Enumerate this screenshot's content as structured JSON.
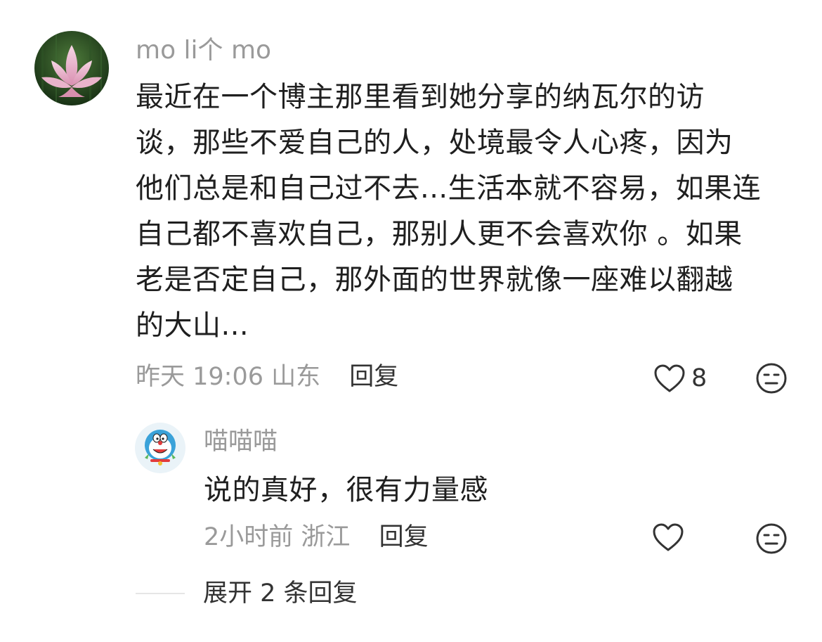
{
  "comment": {
    "avatar_icon": "lotus-flower-avatar",
    "username": "mo li个 mo",
    "lines": [
      "最近在一个博主那里看到她分享的纳瓦尔的访",
      "谈，那些不爱自己的人，处境最令人心疼，因为",
      "他们总是和自己过不去...生活本就不容易，如果连",
      "自己都不喜欢自己，那别人更不会喜欢你 。如果",
      "老是否定自己，那外面的世界就像一座难以翻越",
      "的大山..."
    ],
    "time": "昨天 19:06",
    "location": "山东",
    "reply_label": "回复",
    "like_count": "8",
    "like_icon": "heart-outline-icon",
    "dislike_icon": "meh-face-icon"
  },
  "reply": {
    "avatar_icon": "doraemon-avatar",
    "username": "喵喵喵",
    "text": "说的真好，很有力量感",
    "time": "2小时前",
    "location": "浙江",
    "reply_label": "回复",
    "like_icon": "heart-outline-icon",
    "dislike_icon": "meh-face-icon"
  },
  "expand": {
    "label": "展开 2 条回复"
  },
  "colors": {
    "meta_gray": "#9a9a9a",
    "text_dark": "#1f1f1f",
    "action_dark": "#333333"
  }
}
